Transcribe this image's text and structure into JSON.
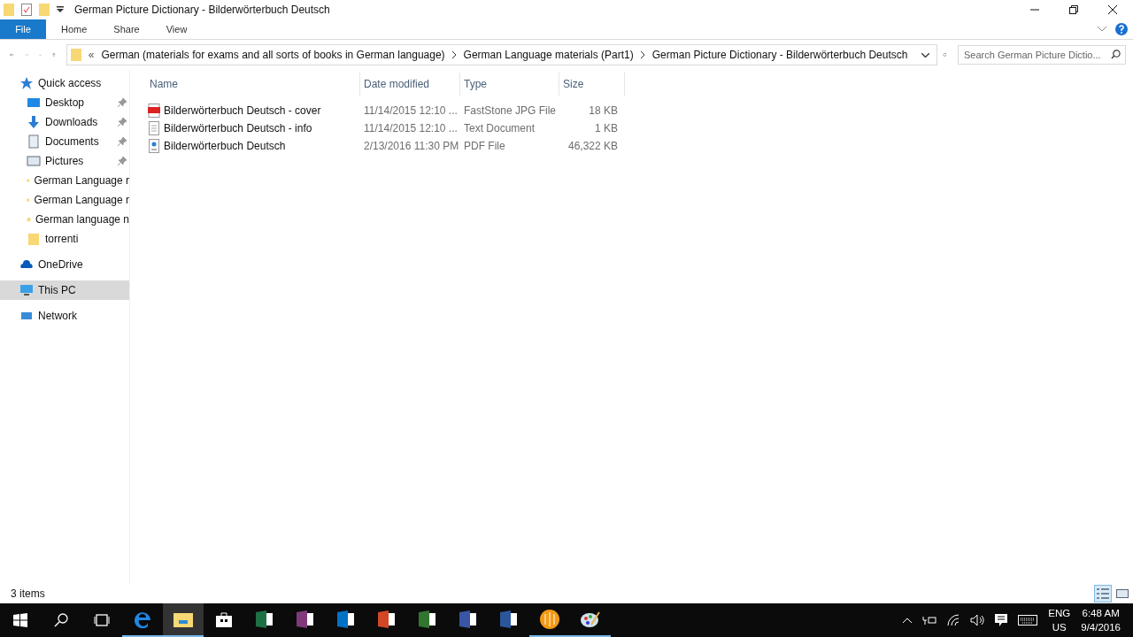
{
  "window": {
    "title": "German Picture Dictionary - Bilderwörterbuch Deutsch"
  },
  "ribbon_tabs": [
    {
      "label": "File",
      "kind": "file"
    },
    {
      "label": "Home",
      "kind": "tab"
    },
    {
      "label": "Share",
      "kind": "tab"
    },
    {
      "label": "View",
      "kind": "tab"
    }
  ],
  "address": {
    "overflow": "«",
    "crumbs": [
      "German (materials for exams and all sorts of books in German language)",
      "German Language materials (Part1)",
      "German Picture Dictionary - Bilderwörterbuch Deutsch"
    ]
  },
  "search": {
    "placeholder": "Search German Picture Dictio..."
  },
  "sidebar": {
    "items": [
      {
        "label": "Quick access",
        "kind": "star",
        "selected": false,
        "children": [
          {
            "label": "Desktop",
            "kind": "desktop",
            "pinned": true,
            "selected": false
          },
          {
            "label": "Downloads",
            "kind": "download",
            "pinned": true,
            "selected": false
          },
          {
            "label": "Documents",
            "kind": "documents",
            "pinned": true,
            "selected": false
          },
          {
            "label": "Pictures",
            "kind": "pictures",
            "pinned": true,
            "selected": false
          },
          {
            "label": "German Language r",
            "kind": "folder",
            "pinned": false,
            "selected": false
          },
          {
            "label": "German Language r",
            "kind": "folder",
            "pinned": false,
            "selected": false
          },
          {
            "label": "German language n",
            "kind": "folder",
            "pinned": false,
            "selected": false
          },
          {
            "label": "torrenti",
            "kind": "folder",
            "pinned": false,
            "selected": false
          }
        ]
      },
      {
        "label": "OneDrive",
        "kind": "cloud",
        "selected": false
      },
      {
        "label": "This PC",
        "kind": "pc",
        "selected": true
      },
      {
        "label": "Network",
        "kind": "network",
        "selected": false
      }
    ]
  },
  "table": {
    "columns": [
      "Name",
      "Date modified",
      "Type",
      "Size"
    ],
    "rows": [
      {
        "kind": "image",
        "name": "Bilderwörterbuch Deutsch - cover",
        "date": "11/14/2015 12:10 ...",
        "type": "FastStone JPG File",
        "size": "18 KB"
      },
      {
        "kind": "text",
        "name": "Bilderwörterbuch Deutsch - info",
        "date": "11/14/2015 12:10 ...",
        "type": "Text Document",
        "size": "1 KB"
      },
      {
        "kind": "pdf",
        "name": "Bilderwörterbuch Deutsch",
        "date": "2/13/2016 11:30 PM",
        "type": "PDF File",
        "size": "46,322 KB"
      }
    ]
  },
  "status_bar": {
    "count": "3 items",
    "views": [
      {
        "kind": "details",
        "selected": true
      },
      {
        "kind": "large",
        "selected": false
      }
    ]
  },
  "taskbar": {
    "apps": [
      {
        "kind": "edge",
        "running": true,
        "selected": false
      },
      {
        "kind": "explorer",
        "running": true,
        "selected": true
      },
      {
        "kind": "store",
        "running": false,
        "selected": false
      },
      {
        "kind": "excel",
        "running": false,
        "selected": false
      },
      {
        "kind": "onenote",
        "running": false,
        "selected": false
      },
      {
        "kind": "outlook",
        "running": false,
        "selected": false
      },
      {
        "kind": "powerpoint",
        "running": false,
        "selected": false
      },
      {
        "kind": "project",
        "running": false,
        "selected": false
      },
      {
        "kind": "visio",
        "running": false,
        "selected": false
      },
      {
        "kind": "word",
        "running": false,
        "selected": false
      },
      {
        "kind": "orb",
        "running": true,
        "selected": false
      },
      {
        "kind": "paint",
        "running": true,
        "selected": false
      }
    ],
    "language": "ENG",
    "region": "US",
    "time": "6:48 AM",
    "date": "9/4/2016"
  }
}
